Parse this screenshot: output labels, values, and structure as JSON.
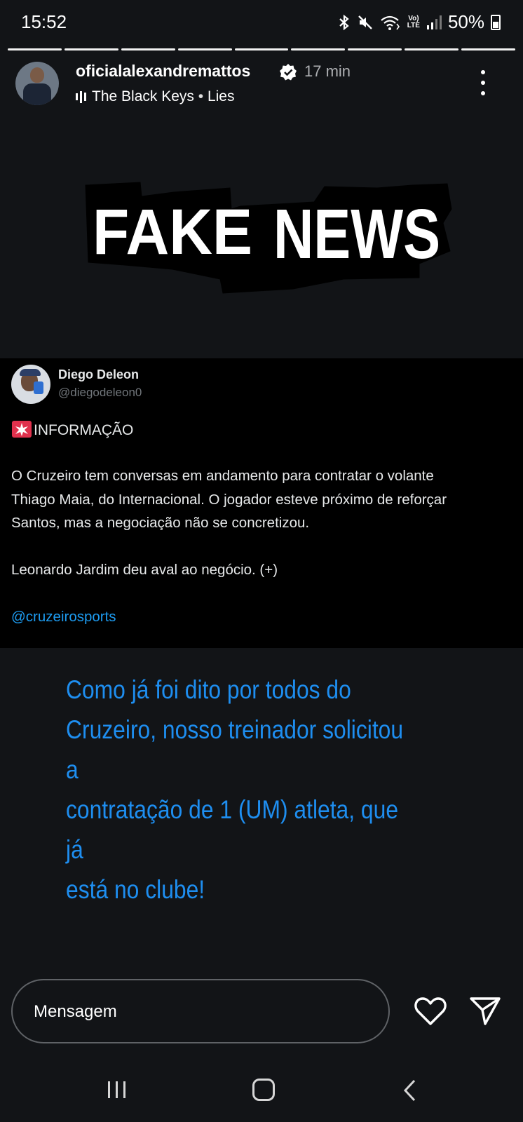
{
  "status_bar": {
    "time": "15:52",
    "lte_label_top": "Vo)",
    "lte_label_bottom": "LTE",
    "battery": "50%",
    "icons": [
      "bluetooth-icon",
      "mute-icon",
      "wifi-icon",
      "signal-icon",
      "battery-icon"
    ]
  },
  "story": {
    "segments_total": 9,
    "segments_viewed": 9,
    "username": "oficialalexandremattos",
    "time_ago": "17 min",
    "music": {
      "artist": "The Black Keys",
      "separator": " • ",
      "song": "Lies"
    }
  },
  "graphic": {
    "word1": "FAKE",
    "word2": "NEWS"
  },
  "tweet": {
    "name": "Diego Deleon",
    "handle": "@diegodeleon0",
    "heading": "INFORMAÇÃO",
    "line1": "O Cruzeiro tem conversas em andamento para contratar o volante",
    "line2": "Thiago Maia, do Internacional. O jogador esteve próximo de reforçar",
    "line3": "Santos, mas a negociação não se concretizou.",
    "line4": "Leonardo Jardim deu aval ao negócio. (+)",
    "mention": "@cruzeirosports"
  },
  "overlay": {
    "line1": "Como já foi dito por todos do",
    "line2": "Cruzeiro, nosso treinador solicitou a",
    "line3": "contratação de 1 (UM) atleta, que já",
    "line4": "está no clube!",
    "color": "#1e8ef0"
  },
  "reply": {
    "placeholder": "Mensagem"
  },
  "colors": {
    "background": "#121417",
    "tweet_background": "#000000",
    "link_blue": "#1d9bf0"
  }
}
